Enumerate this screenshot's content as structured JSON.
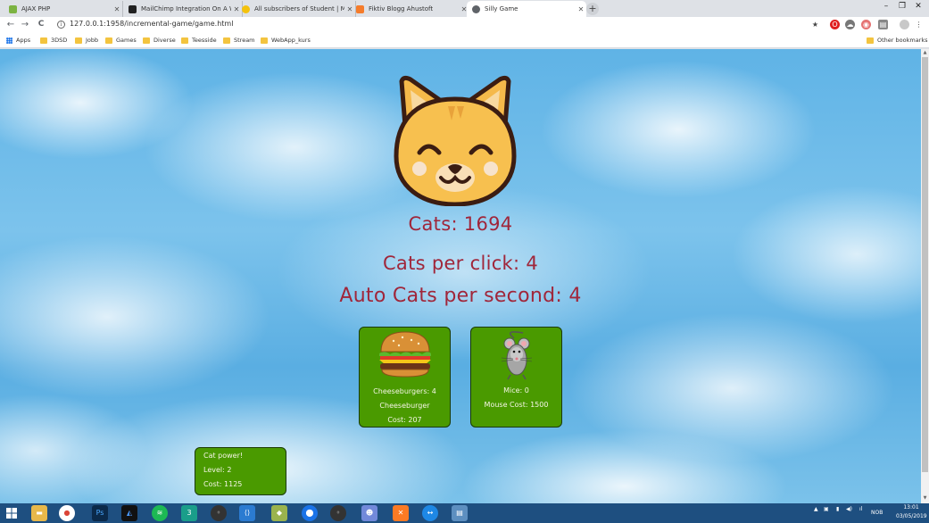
{
  "tabs": [
    {
      "title": "AJAX PHP",
      "color": "#7cb342",
      "active": false
    },
    {
      "title": "MailChimp Integration On A Wel",
      "color": "#222222",
      "active": false
    },
    {
      "title": "All subscribers of Student | Mail",
      "color": "#f4c20d",
      "active": false
    },
    {
      "title": "Fiktiv Blogg Ahustoft",
      "color": "#f57c2b",
      "active": false
    },
    {
      "title": "Silly Game",
      "color": "#5f6368",
      "active": true
    }
  ],
  "new_tab_label": "+",
  "window_controls": {
    "minimize": "–",
    "maximize": "❐",
    "close": "✕"
  },
  "address": {
    "url": "127.0.0.1:1958/incremental-game/game.html",
    "back": "←",
    "forward": "→",
    "reload": "C"
  },
  "bookmarks": {
    "apps": "Apps",
    "items": [
      "3DSD",
      "Jobb",
      "Games",
      "Diverse",
      "Teesside",
      "Stream",
      "WebApp_kurs"
    ],
    "other": "Other bookmarks"
  },
  "game": {
    "cats_label": "Cats: 1694",
    "per_click_label": "Cats per click: 4",
    "auto_label": "Auto Cats per second: 4",
    "cheeseburger_card": {
      "count": "Cheeseburgers: 4",
      "name": "Cheeseburger",
      "cost": "Cost: 207"
    },
    "mouse_card": {
      "count": "Mice: 0",
      "cost": "Mouse Cost: 1500"
    },
    "power_card": {
      "title": "Cat power!",
      "level": "Level: 2",
      "cost": "Cost: 1125"
    }
  },
  "taskbar": {
    "tray_lang": "NOB",
    "time": "13:01",
    "date": "03/05/2019"
  },
  "colors": {
    "stat_text": "#a0263a",
    "card_green": "#4a9a00",
    "taskbar": "#1e4f80"
  }
}
